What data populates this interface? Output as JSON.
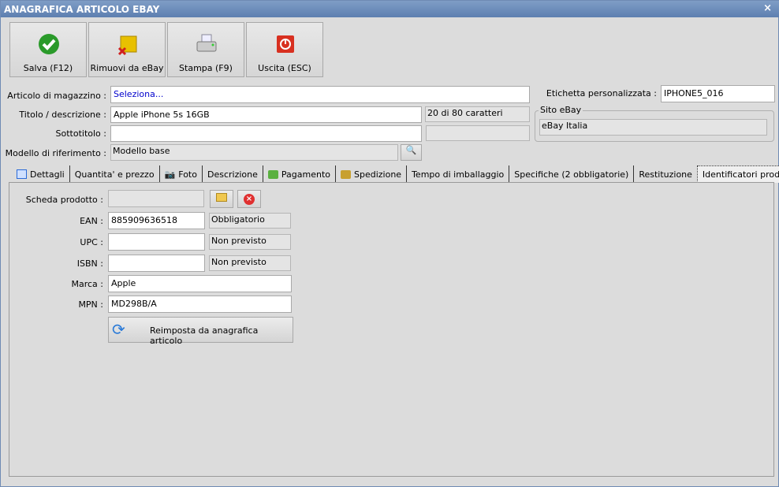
{
  "window": {
    "title": "ANAGRAFICA ARTICOLO EBAY",
    "close": "×"
  },
  "toolbar": [
    {
      "label": "Salva (F12)",
      "icon": "check-icon"
    },
    {
      "label": "Rimuovi da eBay",
      "icon": "box-remove-icon"
    },
    {
      "label": "Stampa (F9)",
      "icon": "printer-icon"
    },
    {
      "label": "Uscita (ESC)",
      "icon": "power-icon"
    }
  ],
  "form": {
    "articolo_label": "Articolo di magazzino :",
    "articolo_value": "Seleziona...",
    "titolo_label": "Titolo / descrizione :",
    "titolo_value": "Apple iPhone 5s 16GB",
    "titolo_counter": "20 di 80 caratteri",
    "sottotitolo_label": "Sottotitolo :",
    "sottotitolo_value": "",
    "modello_label": "Modello di riferimento :",
    "modello_value": "Modello base",
    "etichetta_label": "Etichetta personalizzata :",
    "etichetta_value": "IPHONE5_016",
    "sito_label": "Sito eBay",
    "sito_value": "eBay Italia"
  },
  "tabs": [
    {
      "label": "Dettagli",
      "icon": "calendar-icon"
    },
    {
      "label": "Quantita' e prezzo"
    },
    {
      "label": "Foto",
      "icon": "camera-icon"
    },
    {
      "label": "Descrizione"
    },
    {
      "label": "Pagamento",
      "icon": "money-icon"
    },
    {
      "label": "Spedizione",
      "icon": "shipping-icon"
    },
    {
      "label": "Tempo di imballaggio"
    },
    {
      "label": "Specifiche (2 obbligatorie)"
    },
    {
      "label": "Restituzione"
    },
    {
      "label": "Identificatori prodotto",
      "active": true
    }
  ],
  "ident": {
    "scheda_label": "Scheda prodotto :",
    "scheda_value": "",
    "ean_label": "EAN :",
    "ean_value": "885909636518",
    "ean_status": "Obbligatorio",
    "upc_label": "UPC :",
    "upc_value": "",
    "upc_status": "Non previsto",
    "isbn_label": "ISBN :",
    "isbn_value": "",
    "isbn_status": "Non previsto",
    "marca_label": "Marca :",
    "marca_value": "Apple",
    "mpn_label": "MPN :",
    "mpn_value": "MD298B/A",
    "reset_label": "Reimposta da anagrafica articolo"
  },
  "colors": {
    "titlebar": "#5d7fb0",
    "link": "#0000cc"
  }
}
